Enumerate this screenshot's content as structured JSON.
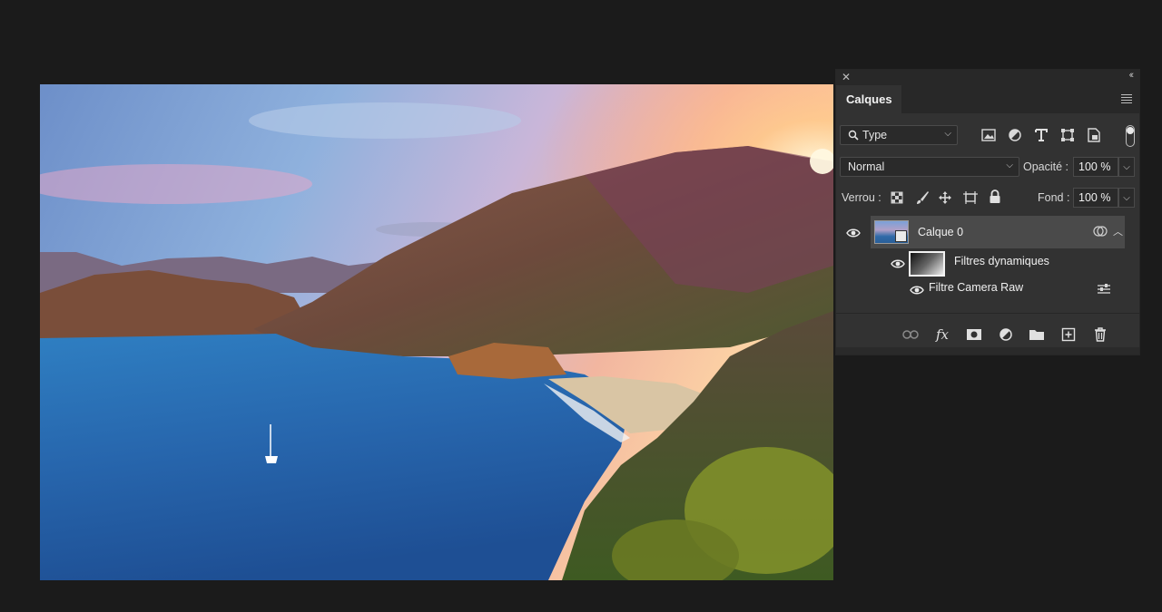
{
  "panel": {
    "tab_label": "Calques",
    "filter": {
      "selected": "Type"
    },
    "blend_mode": {
      "selected": "Normal"
    },
    "opacity": {
      "label": "Opacité :",
      "value": "100 %"
    },
    "lock": {
      "label": "Verrou :"
    },
    "fill": {
      "label": "Fond :",
      "value": "100 %"
    },
    "layers": [
      {
        "name": "Calque 0",
        "visible": true,
        "selected": true
      },
      {
        "name": "Filtres dynamiques",
        "visible": true
      },
      {
        "name": "Filtre Camera Raw",
        "visible": true
      }
    ],
    "filter_icons": [
      "image-filter-icon",
      "adjustment-filter-icon",
      "text-filter-icon",
      "shape-filter-icon",
      "smart-object-filter-icon"
    ],
    "lock_icons": [
      "lock-transparency-icon",
      "lock-pixels-icon",
      "lock-position-icon",
      "lock-artboard-icon",
      "lock-all-icon"
    ],
    "bottom_icons": [
      "link-layers-icon",
      "fx-icon",
      "layer-mask-icon",
      "adjustment-layer-icon",
      "group-folder-icon",
      "new-layer-icon",
      "trash-icon"
    ]
  },
  "colors": {
    "app_background": "#1b1b1b",
    "panel_background": "#323232",
    "selected_layer": "#4a4a4a"
  }
}
